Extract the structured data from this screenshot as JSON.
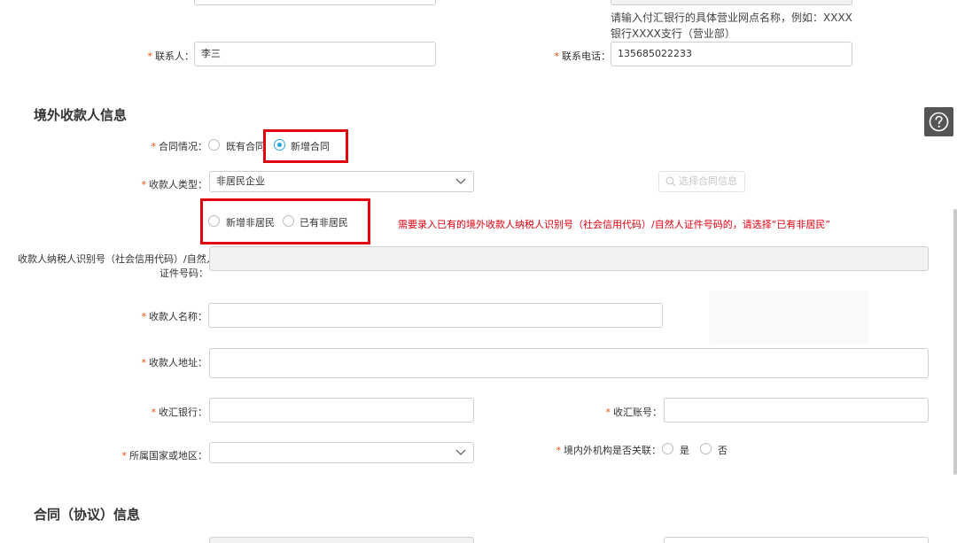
{
  "top": {
    "hint": "请输入付汇银行的具体营业网点名称，例如：XXXX银行XXXX支行（营业部）",
    "contact_label": "联系人：",
    "contact_value": "李三",
    "phone_label": "联系电话：",
    "phone_value": "135685022233"
  },
  "payee_section": {
    "title": "境外收款人信息",
    "contract_status_label": "合同情况：",
    "contract_options": [
      "既有合同",
      "新增合同"
    ],
    "contract_selected": "新增合同",
    "payee_type_label": "收款人类型：",
    "payee_type_value": "非居民企业",
    "select_contract_button": "选择合同信息",
    "resident_options": [
      "新增非居民",
      "已有非居民"
    ],
    "warning": "需要录入已有的境外收款人纳税人识别号（社会信用代码）/自然人证件号码的，请选择“已有非居民”",
    "tax_id_label_line1": "收款人纳税人识别号（社会信用代码）/自然人",
    "tax_id_label_line2": "证件号码：",
    "payee_name_label": "收款人名称：",
    "payee_address_label": "收款人地址：",
    "receiving_bank_label": "收汇银行：",
    "receiving_account_label": "收汇账号：",
    "country_label": "所属国家或地区：",
    "related_label": "境内外机构是否关联：",
    "related_options": [
      "是",
      "否"
    ]
  },
  "contract_section": {
    "title": "合同（协议）信息"
  },
  "colors": {
    "required": "#e8500a",
    "highlight_box": "#e3000f",
    "radio_active": "#29a3e8"
  },
  "icons": {
    "help": "question-circle-icon",
    "dropdown": "chevron-down-icon",
    "search": "search-icon"
  }
}
